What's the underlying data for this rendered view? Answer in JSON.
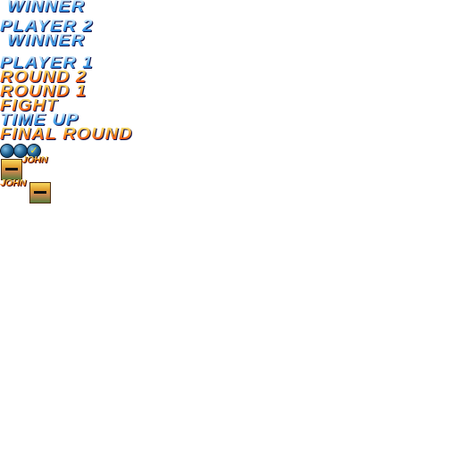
{
  "sprites": {
    "winner_1": "WINNER",
    "player_2": "PLAYER 2",
    "winner_2": "WINNER",
    "player_1": "PLAYER 1",
    "round_2": "ROUND 2",
    "round_1": "ROUND 1",
    "fight": "FIGHT",
    "time_up": "TIME UP",
    "final_round": "FINAL ROUND",
    "name_1": "JOHN",
    "name_2": "JOHN",
    "check": "✓"
  },
  "colors": {
    "blue_text": "#3a90e0",
    "orange_text": "#f87018",
    "outline": "#101048"
  }
}
